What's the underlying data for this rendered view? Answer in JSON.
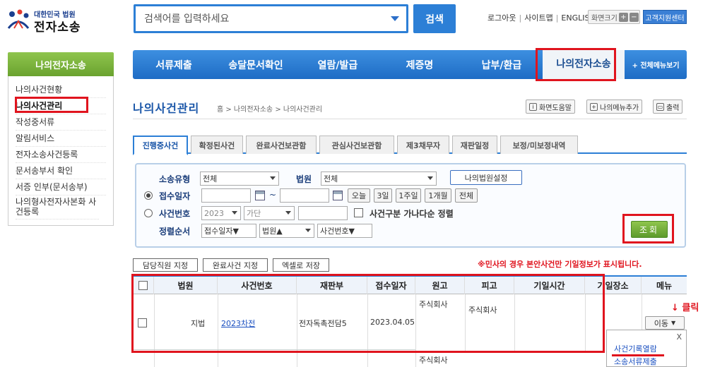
{
  "logo": {
    "sub": "대한민국 법원",
    "main": "전자소송"
  },
  "search": {
    "placeholder": "검색어를 입력하세요",
    "button": "검색"
  },
  "toplinks": {
    "logout": "로그아웃",
    "sitemap": "사이트맵",
    "english": "ENGLISH",
    "fontsize": "화면크기",
    "plus": "+",
    "minus": "−",
    "support": "고객지원센터"
  },
  "sidebar": {
    "title": "나의전자소송",
    "items": [
      {
        "label": "나의사건현황"
      },
      {
        "label": "나의사건관리"
      },
      {
        "label": "작성중서류"
      },
      {
        "label": "알림서비스"
      },
      {
        "label": "전자소송사건등록"
      },
      {
        "label": "문서송부서 확인"
      },
      {
        "label": "서증 인부(문서송부)"
      },
      {
        "label": "나의형사전자사본화 사건등록"
      }
    ]
  },
  "gnb": {
    "items": [
      {
        "label": "서류제출"
      },
      {
        "label": "송달문서확인"
      },
      {
        "label": "열람/발급"
      },
      {
        "label": "제증명"
      },
      {
        "label": "납부/환급"
      },
      {
        "label": "나의전자소송"
      }
    ],
    "allmenu": "+ 전체메뉴보기"
  },
  "page": {
    "title": "나의사건관리",
    "breadcrumb": "홈 > 나의전자소송 > 나의사건관리",
    "help": "화면도움말",
    "mymenu": "나의메뉴추가",
    "print": "출력"
  },
  "tabs": [
    {
      "label": "진행중사건"
    },
    {
      "label": "확정된사건"
    },
    {
      "label": "완료사건보관함"
    },
    {
      "label": "관심사건보관함"
    },
    {
      "label": "제3채무자"
    },
    {
      "label": "재판일정"
    },
    {
      "label": "보정/미보정내역"
    }
  ],
  "filter": {
    "type_label": "소송유형",
    "type_value": "전체",
    "court_label": "법원",
    "court_value": "전체",
    "my_court_btn": "나의법원설정",
    "date_label": "접수일자",
    "tilde": "~",
    "btn_today": "오늘",
    "btn_3days": "3일",
    "btn_1week": "1주일",
    "btn_1month": "1개월",
    "btn_all": "전체",
    "case_label": "사건번호",
    "year_value": "2023",
    "gubun_value": "가단",
    "sort_check_label": "사건구분 가나다순 정렬",
    "order_label": "정렬순서",
    "order1": "접수일자▼",
    "order2": "법원▲",
    "order3": "사건번호▼",
    "search_btn": "조회"
  },
  "actions": {
    "assign": "담당직원 지정",
    "complete": "완료사건 지정",
    "excel": "엑셀로 저장"
  },
  "notice": "※민사의 경우 본안사건만 기일정보가 표시됩니다.",
  "table": {
    "headers": [
      "법원",
      "사건번호",
      "재판부",
      "접수일자",
      "원고",
      "피고",
      "기일시간",
      "기일장소",
      "메뉴"
    ],
    "rows": [
      {
        "court": "지법",
        "case_no": "2023차전",
        "panel": "전자독촉전담5",
        "date": "2023.04.05",
        "plaintiff": "주식회사",
        "defendant": "주식회사"
      }
    ],
    "row2_plaintiff": "주식회사"
  },
  "menu": {
    "move": "이동",
    "click_note": "↓ 클릭",
    "popup_close": "X",
    "popup_item1": "사건기록열람",
    "popup_item2": "소송서류제출"
  }
}
